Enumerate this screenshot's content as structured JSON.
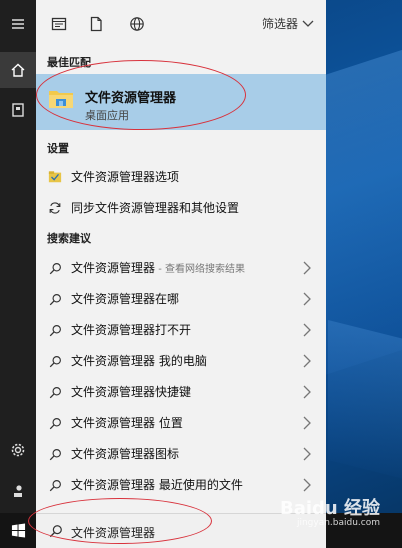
{
  "top_bar": {
    "filter_label": "筛选器"
  },
  "sections": {
    "best_match": "最佳匹配",
    "settings": "设置",
    "suggestions": "搜索建议"
  },
  "best_match": {
    "title": "文件资源管理器",
    "subtitle": "桌面应用"
  },
  "settings_items": [
    {
      "label": "文件资源管理器选项"
    },
    {
      "label": "同步文件资源管理器和其他设置"
    }
  ],
  "suggestions": [
    {
      "label": "文件资源管理器",
      "hint": " - 查看网络搜索结果"
    },
    {
      "label": "文件资源管理器在哪",
      "hint": ""
    },
    {
      "label": "文件资源管理器打不开",
      "hint": ""
    },
    {
      "label": "文件资源管理器 我的电脑",
      "hint": ""
    },
    {
      "label": "文件资源管理器快捷键",
      "hint": ""
    },
    {
      "label": "文件资源管理器 位置",
      "hint": ""
    },
    {
      "label": "文件资源管理器图标",
      "hint": ""
    },
    {
      "label": "文件资源管理器 最近使用的文件",
      "hint": ""
    }
  ],
  "search": {
    "value": "文件资源管理器"
  },
  "watermark": {
    "text": "Baidu 经验",
    "url": "jingyan.baidu.com"
  },
  "colors": {
    "best_match_bg": "#a8cde8",
    "annotation": "#d8323c",
    "rail": "#1f1f1f"
  }
}
